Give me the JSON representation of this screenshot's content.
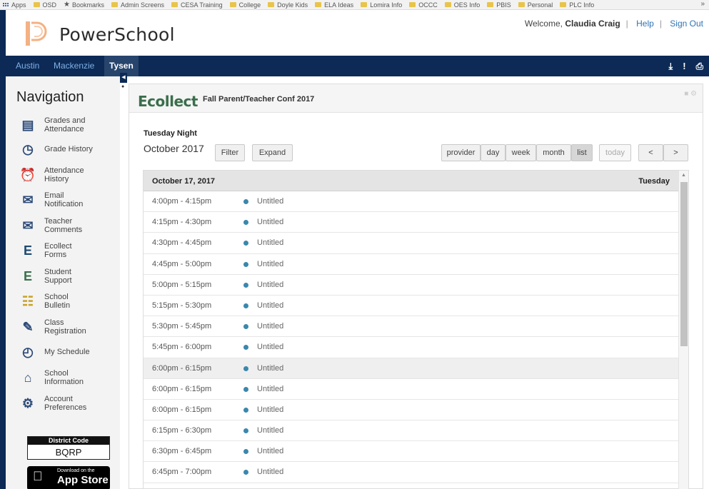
{
  "bookmarks": {
    "items": [
      {
        "label": "Apps",
        "icon": "apps-grid-icon"
      },
      {
        "label": "OSD",
        "icon": "folder-icon"
      },
      {
        "label": "Bookmarks",
        "icon": "star-icon"
      },
      {
        "label": "Admin Screens",
        "icon": "folder-icon"
      },
      {
        "label": "CESA Training",
        "icon": "folder-icon"
      },
      {
        "label": "College",
        "icon": "folder-icon"
      },
      {
        "label": "Doyle Kids",
        "icon": "folder-icon"
      },
      {
        "label": "ELA Ideas",
        "icon": "folder-icon"
      },
      {
        "label": "Lomira Info",
        "icon": "folder-icon"
      },
      {
        "label": "OCCC",
        "icon": "folder-icon"
      },
      {
        "label": "OES Info",
        "icon": "folder-icon"
      },
      {
        "label": "PBIS",
        "icon": "folder-icon"
      },
      {
        "label": "Personal",
        "icon": "folder-icon"
      },
      {
        "label": "PLC Info",
        "icon": "folder-icon"
      }
    ],
    "more": "»"
  },
  "header": {
    "brand": "PowerSchool",
    "welcome": "Welcome,",
    "user": "Claudia Craig",
    "help": "Help",
    "signout": "Sign Out"
  },
  "students": [
    "Austin",
    "Mackenzie",
    "Tysen"
  ],
  "active_student": "Tysen",
  "nav_icons": {
    "download": "⤓",
    "alert": "!",
    "print": "⎙"
  },
  "navigation": {
    "title": "Navigation",
    "items": [
      {
        "label": "Grades and Attendance",
        "icon": "grades-icon"
      },
      {
        "label": "Grade History",
        "icon": "grade-history-icon"
      },
      {
        "label": "Attendance History",
        "icon": "attendance-history-icon"
      },
      {
        "label": "Email Notification",
        "icon": "email-icon"
      },
      {
        "label": "Teacher Comments",
        "icon": "comments-icon"
      },
      {
        "label": "Ecollect Forms",
        "icon": "ecollect-icon"
      },
      {
        "label": "Student Support",
        "icon": "student-support-icon"
      },
      {
        "label": "School Bulletin",
        "icon": "bulletin-icon"
      },
      {
        "label": "Class Registration",
        "icon": "class-registration-icon"
      },
      {
        "label": "My Schedule",
        "icon": "schedule-icon"
      },
      {
        "label": "School Information",
        "icon": "school-icon"
      },
      {
        "label": "Account Preferences",
        "icon": "preferences-icon"
      }
    ],
    "district_code_label": "District Code",
    "district_code": "BQRP",
    "appstore_small": "Download on the",
    "appstore_big": "App Store"
  },
  "panel": {
    "logo": "Ecollect",
    "title": "Fall Parent/Teacher Conf 2017",
    "subtitle": "Tuesday Night",
    "month": "October 2017",
    "filter": "Filter",
    "expand": "Expand",
    "views": [
      "provider",
      "day",
      "week",
      "month",
      "list"
    ],
    "active_view": "list",
    "today": "today",
    "prev": "<",
    "next": ">"
  },
  "calendar": {
    "date_label": "October 17, 2017",
    "day_label": "Tuesday",
    "event_color": "#3a87ad",
    "rows": [
      {
        "time": "4:00pm - 4:15pm",
        "title": "Untitled"
      },
      {
        "time": "4:15pm - 4:30pm",
        "title": "Untitled"
      },
      {
        "time": "4:30pm - 4:45pm",
        "title": "Untitled"
      },
      {
        "time": "4:45pm - 5:00pm",
        "title": "Untitled"
      },
      {
        "time": "5:00pm - 5:15pm",
        "title": "Untitled"
      },
      {
        "time": "5:15pm - 5:30pm",
        "title": "Untitled"
      },
      {
        "time": "5:30pm - 5:45pm",
        "title": "Untitled"
      },
      {
        "time": "5:45pm - 6:00pm",
        "title": "Untitled"
      },
      {
        "time": "6:00pm - 6:15pm",
        "title": "Untitled",
        "highlight": true
      },
      {
        "time": "6:00pm - 6:15pm",
        "title": "Untitled"
      },
      {
        "time": "6:00pm - 6:15pm",
        "title": "Untitled"
      },
      {
        "time": "6:15pm - 6:30pm",
        "title": "Untitled"
      },
      {
        "time": "6:30pm - 6:45pm",
        "title": "Untitled"
      },
      {
        "time": "6:45pm - 7:00pm",
        "title": "Untitled"
      }
    ]
  }
}
